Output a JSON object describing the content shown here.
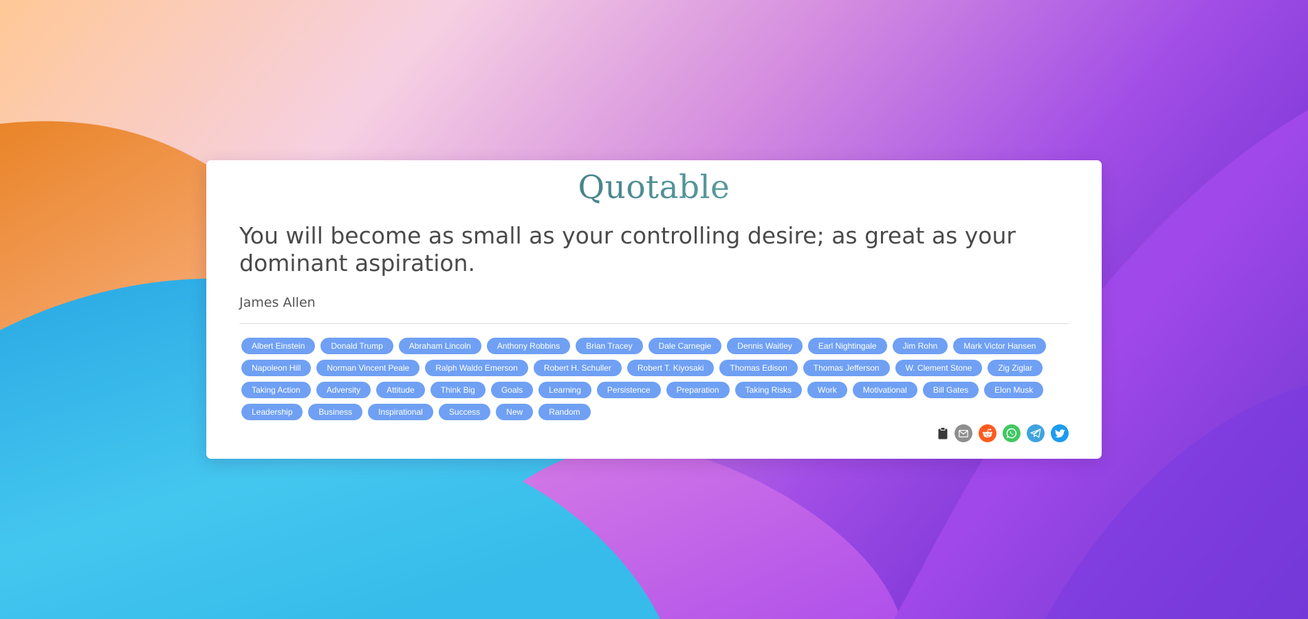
{
  "app": {
    "logo": "Quotable"
  },
  "quote": {
    "text": "You will become as small as your controlling desire; as great as your dominant aspiration.",
    "author": "James Allen"
  },
  "tags": [
    "Albert Einstein",
    "Donald Trump",
    "Abraham Lincoln",
    "Anthony Robbins",
    "Brian Tracey",
    "Dale Carnegie",
    "Dennis Waitley",
    "Earl Nightingale",
    "Jim Rohn",
    "Mark Victor Hansen",
    "Napoleon Hill",
    "Norman Vincent Peale",
    "Ralph Waldo Emerson",
    "Robert H. Schuller",
    "Robert T. Kiyosaki",
    "Thomas Edison",
    "Thomas Jefferson",
    "W. Clement Stone",
    "Zig Ziglar",
    "Taking Action",
    "Adversity",
    "Attitude",
    "Think Big",
    "Goals",
    "Learning",
    "Persistence",
    "Preparation",
    "Taking Risks",
    "Work",
    "Motivational",
    "Bill Gates",
    "Elon Musk",
    "Leadership",
    "Business",
    "Inspirational",
    "Success",
    "New",
    "Random"
  ],
  "share": {
    "icons": [
      "clipboard-icon",
      "email-icon",
      "reddit-icon",
      "whatsapp-icon",
      "telegram-icon",
      "twitter-icon"
    ],
    "colors": {
      "clipboard": "#3a3a3a",
      "email": "#8e8e8e",
      "reddit": "#ff5a1f",
      "whatsapp": "#41c862",
      "telegram": "#3fa3e0",
      "twitter": "#1d9bf0"
    }
  },
  "theme": {
    "tag_color": "#6fa0f4",
    "logo_gradient": [
      "#32525c",
      "#7fd8c7"
    ]
  }
}
